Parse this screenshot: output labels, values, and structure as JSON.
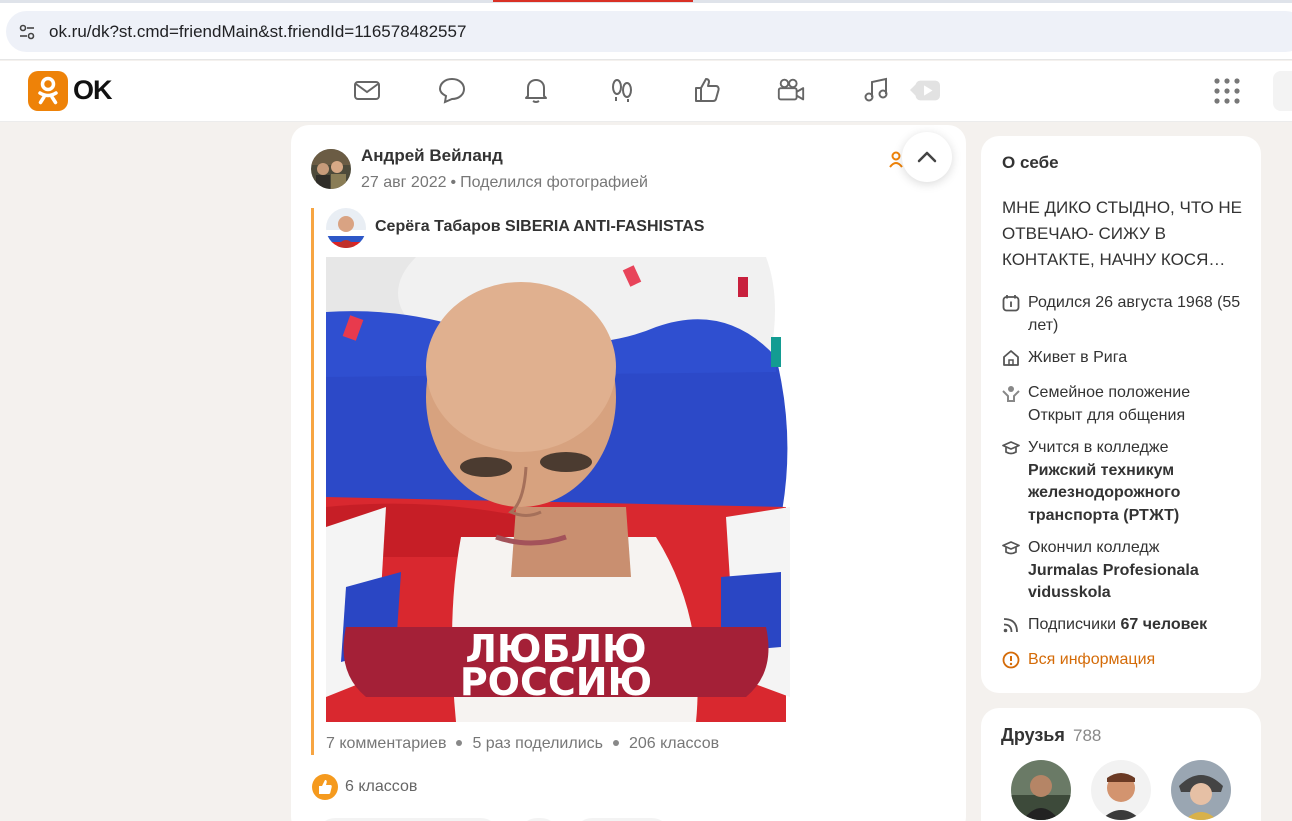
{
  "browser": {
    "url": "ok.ru/dk?st.cmd=friendMain&st.friendId=116578482557"
  },
  "header": {
    "logo_text": "OK",
    "brand_color": "#ee8208",
    "nav_icons": [
      "mail-icon",
      "chat-icon",
      "bell-icon",
      "guests-icon",
      "like-icon",
      "video-camera-icon",
      "music-icon",
      "video-icon",
      "apps-grid-icon"
    ]
  },
  "post": {
    "author": "Андрей Вейланд",
    "date": "27 авг 2022",
    "action": "Поделился фотографией",
    "shared_author": "Серёга Табаров SIBERIA ANTI-FASHISTAS",
    "image_text_line1": "ЛЮБЛЮ",
    "image_text_line2": "РОССИЮ",
    "comments": "7 комментариев",
    "shares": "5 раз поделились",
    "classes": "206 классов",
    "likes": "6 классов",
    "accent_color": "#f7a542"
  },
  "about": {
    "title": "О себе",
    "status": "МНЕ ДИКО СТЫДНО, ЧТО НЕ ОТВЕЧАЮ- СИЖУ В КОНТАКТЕ, НАЧНУ КОСЯ…",
    "birth": "Родился 26 августа 1968 (55 лет)",
    "lives": "Живет в Рига",
    "family_label": "Семейное положение",
    "family_value": "Открыт для общения",
    "study_label": "Учится в колледже",
    "study_value": "Рижский техникум железнодорожного транспорта (РТЖТ)",
    "graduated_label": "Окончил колледж",
    "graduated_value": "Jurmalas Profesionala vidusskola",
    "subscribers_label": "Подписчики",
    "subscribers_value": "67 человек",
    "all_info": "Вся информация"
  },
  "friends": {
    "title": "Друзья",
    "count": "788"
  }
}
